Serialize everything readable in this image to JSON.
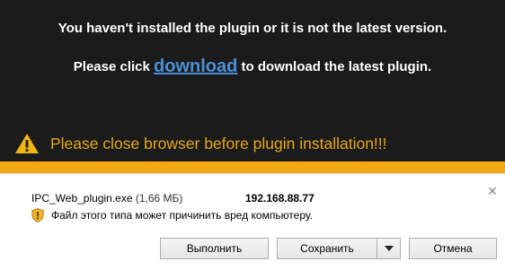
{
  "plugin_notice": {
    "line1": "You haven't installed the plugin or it is not the latest version.",
    "line2_prefix": "Please click",
    "download_link": "download",
    "line2_suffix": "to download the latest plugin.",
    "warning_text": "Please close browser before plugin installation!!!",
    "warning_icon": "warning-triangle-icon"
  },
  "download_bar": {
    "file_name": "IPC_Web_plugin.exe",
    "file_size": "(1,66 МБ)",
    "host": "192.168.88.77",
    "risk_message": "Файл этого типа может причинить вред компьютеру.",
    "risk_icon": "shield-warning-icon",
    "close_icon": "close-icon",
    "buttons": {
      "run": "Выполнить",
      "save": "Сохранить",
      "cancel": "Отмена"
    }
  },
  "colors": {
    "panel_background": "#1b1b1b",
    "link": "#4a8fd6",
    "warning_text": "#e6a817",
    "accent_bar": "#f2a811"
  }
}
